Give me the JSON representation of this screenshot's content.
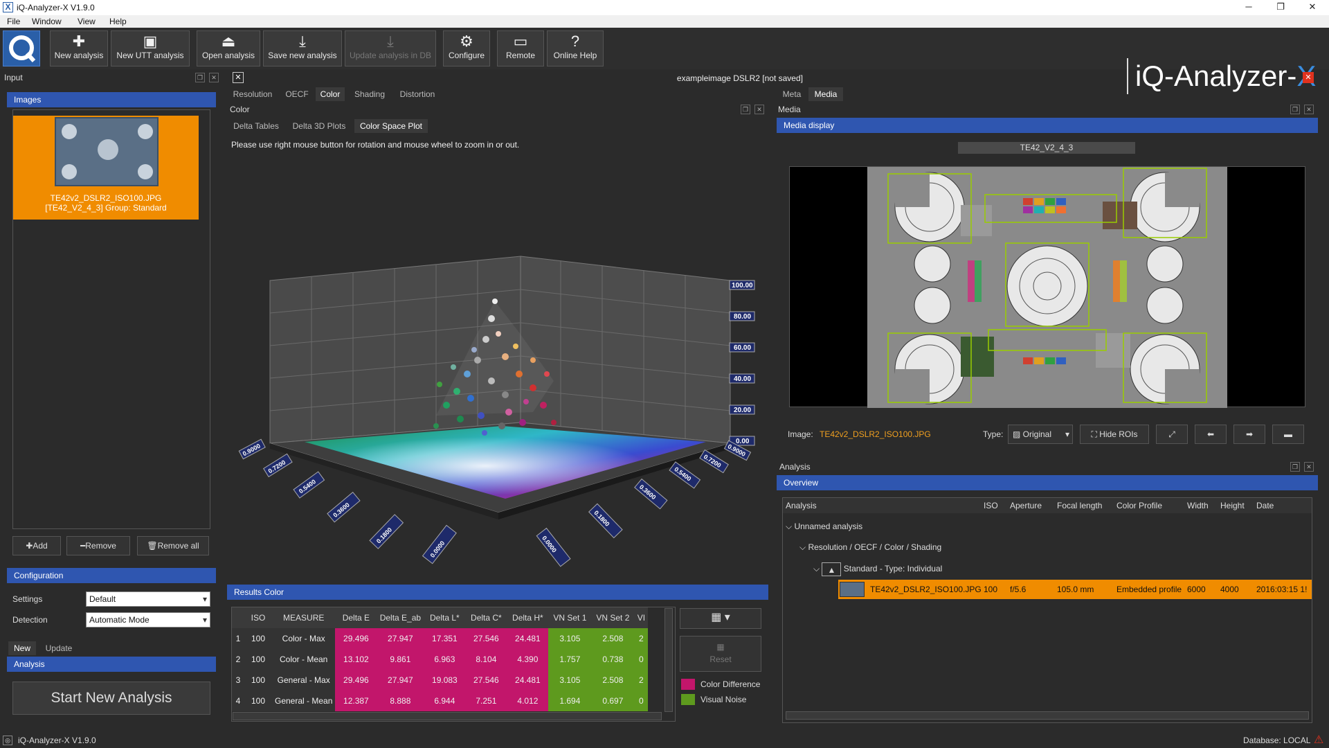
{
  "window": {
    "title": "iQ-Analyzer-X V1.9.0",
    "logo_letter": "X"
  },
  "menu": [
    "File",
    "Window",
    "View",
    "Help"
  ],
  "toolbar": {
    "new_analysis": "New analysis",
    "new_utt": "New UTT analysis",
    "open": "Open analysis",
    "save": "Save new analysis",
    "update": "Update analysis in DB",
    "configure": "Configure",
    "remote": "Remote",
    "help": "Online Help"
  },
  "brand": {
    "text": "iQ-Analyzer-",
    "x": "X"
  },
  "input": {
    "title": "Input",
    "images_hdr": "Images",
    "thumb_line1": "TE42v2_DSLR2_ISO100.JPG",
    "thumb_line2": "[TE42_V2_4_3] Group: Standard",
    "add": "Add",
    "remove": "Remove",
    "remove_all": "Remove all",
    "config_hdr": "Configuration",
    "settings_label": "Settings",
    "settings_value": "Default",
    "detection_label": "Detection",
    "detection_value": "Automatic Mode",
    "tab_new": "New",
    "tab_update": "Update",
    "analysis_hdr": "Analysis",
    "start": "Start New Analysis"
  },
  "center": {
    "doc_title": "exampleimage DSLR2  [not saved]",
    "tabs": [
      "Resolution",
      "OECF",
      "Color",
      "Shading",
      "Distortion"
    ],
    "panel_title": "Color",
    "subtabs": [
      "Delta Tables",
      "Delta 3D Plots",
      "Color Space Plot"
    ],
    "hint": "Please use right mouse button for rotation and mouse wheel to zoom in or out.",
    "yticks": [
      "100.00",
      "80.00",
      "60.00",
      "40.00",
      "20.00",
      "0.00"
    ],
    "xticks_left": [
      "0.9000",
      "0.7200",
      "0.5400",
      "0.3600",
      "0.1800",
      "0.0000"
    ],
    "xticks_right": [
      "0.0000",
      "0.1800",
      "0.3600",
      "0.5400",
      "0.7200",
      "0.9000"
    ]
  },
  "results": {
    "title": "Results Color",
    "columns": [
      "",
      "ISO",
      "MEASURE",
      "Delta E",
      "Delta E_ab",
      "Delta L*",
      "Delta C*",
      "Delta H*",
      "VN Set 1",
      "VN Set 2",
      "VI"
    ],
    "rows": [
      [
        "1",
        "100",
        "Color - Max",
        "29.496",
        "27.947",
        "17.351",
        "27.546",
        "24.481",
        "3.105",
        "2.508",
        "2"
      ],
      [
        "2",
        "100",
        "Color - Mean",
        "13.102",
        "9.861",
        "6.963",
        "8.104",
        "4.390",
        "1.757",
        "0.738",
        "0"
      ],
      [
        "3",
        "100",
        "General - Max",
        "29.496",
        "27.947",
        "19.083",
        "27.546",
        "24.481",
        "3.105",
        "2.508",
        "2"
      ],
      [
        "4",
        "100",
        "General - Mean",
        "12.387",
        "8.888",
        "6.944",
        "7.251",
        "4.012",
        "1.694",
        "0.697",
        "0"
      ]
    ],
    "reset": "Reset",
    "legend": [
      {
        "label": "Color Difference",
        "color": "#c2166b"
      },
      {
        "label": "Visual Noise",
        "color": "#5e9a1e"
      }
    ]
  },
  "media": {
    "tabs": [
      "Meta",
      "Media"
    ],
    "panel_title": "Media",
    "display_hdr": "Media display",
    "chart_name": "TE42_V2_4_3",
    "image_label": "Image:",
    "image_value": "TE42v2_DSLR2_ISO100.JPG",
    "type_label": "Type:",
    "type_value": "Original",
    "hide_rois": "Hide ROIs"
  },
  "analysis": {
    "title": "Analysis",
    "overview_hdr": "Overview",
    "columns": [
      "Analysis",
      "ISO",
      "Aperture",
      "Focal length",
      "Color Profile",
      "Width",
      "Height",
      "Date"
    ],
    "tree1": "Unnamed analysis",
    "tree2": "Resolution / OECF / Color / Shading",
    "tree3": "Standard - Type: Individual",
    "row": {
      "name": "TE42v2_DSLR2_ISO100.JPG",
      "iso": "100",
      "aperture": "f/5.6",
      "focal": "105.0 mm",
      "profile": "Embedded profile",
      "width": "6000",
      "height": "4000",
      "date": "2016:03:15 1!"
    }
  },
  "status": {
    "left": "iQ-Analyzer-X V1.9.0",
    "right": "Database: LOCAL"
  }
}
